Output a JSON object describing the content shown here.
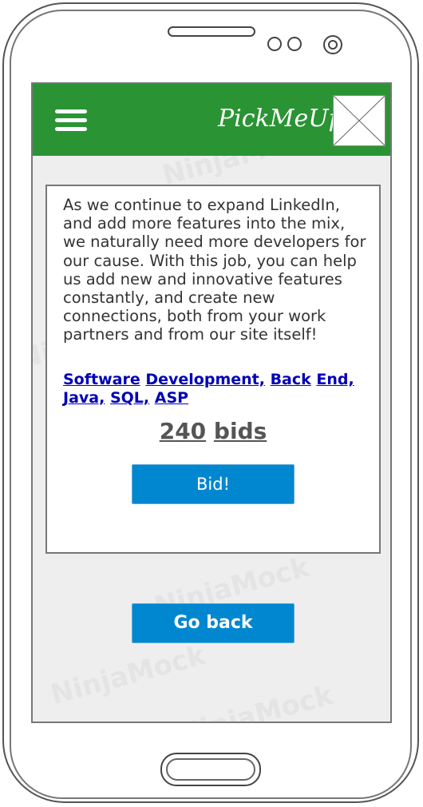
{
  "watermark": "NinjaMock",
  "header": {
    "title": "PickMeUp",
    "menu_icon": "hamburger-menu-icon",
    "image_icon": "image-placeholder-icon"
  },
  "job": {
    "description": "As we continue to expand LinkedIn, and add more features into the mix, we naturally need more developers for our cause. With this job, you can help us add new and innovative features constantly, and create new connections, both from your work partners and from our site itself!",
    "tags": [
      "Software",
      "Development,",
      "Back",
      "End,",
      "Java,",
      "SQL,",
      "ASP"
    ],
    "bids_count": "240",
    "bids_label": "bids",
    "bid_button": "Bid!"
  },
  "footer": {
    "go_back_button": "Go back"
  },
  "colors": {
    "header_bg": "#2a9434",
    "button_bg": "#0087d0",
    "link": "#0000b8"
  }
}
